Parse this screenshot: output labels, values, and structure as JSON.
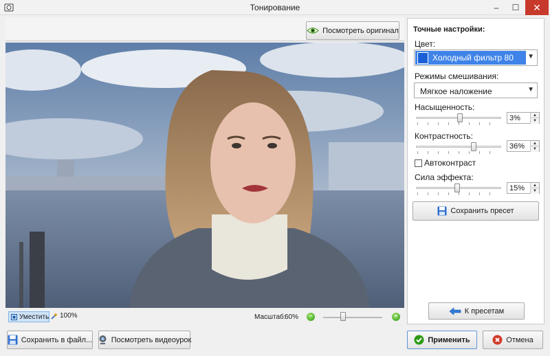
{
  "window": {
    "title": "Тонирование",
    "minimize": "–",
    "maximize": "☐",
    "close": "✕"
  },
  "preview": {
    "view_original_label": "Посмотреть оригинал"
  },
  "statusbar": {
    "fit_label": "Уместить",
    "zoom_100_label": "100%",
    "scale_label": "Масштаб:",
    "scale_value": "60%",
    "zoom_fraction": 0.35
  },
  "settings": {
    "heading": "Точные настройки:",
    "color_label": "Цвет:",
    "color_value": "Холодный фильтр 80",
    "color_swatch": "#1a5fd6",
    "blend_label": "Режимы смешивания:",
    "blend_value": "Мягкое наложение",
    "saturation_label": "Насыщенность:",
    "saturation_value": "3%",
    "saturation_level": 0.52,
    "contrast_label": "Контрастность:",
    "contrast_value": "36%",
    "contrast_level": 0.68,
    "autocontrast_label": "Автоконтраст",
    "autocontrast_checked": false,
    "strength_label": "Сила эффекта:",
    "strength_value": "15%",
    "strength_level": 0.48,
    "save_preset_label": "Сохранить пресет",
    "back_to_presets_label": "К пресетам"
  },
  "footer": {
    "save_to_file_label": "Сохранить в файл...",
    "watch_video_label": "Посмотреть видеоурок",
    "apply_label": "Применить",
    "cancel_label": "Отмена"
  },
  "colors": {
    "accent": "#3f83e8",
    "close": "#c7392b",
    "apply_icon": "#2f9b16",
    "cancel_icon": "#d23b2b"
  }
}
